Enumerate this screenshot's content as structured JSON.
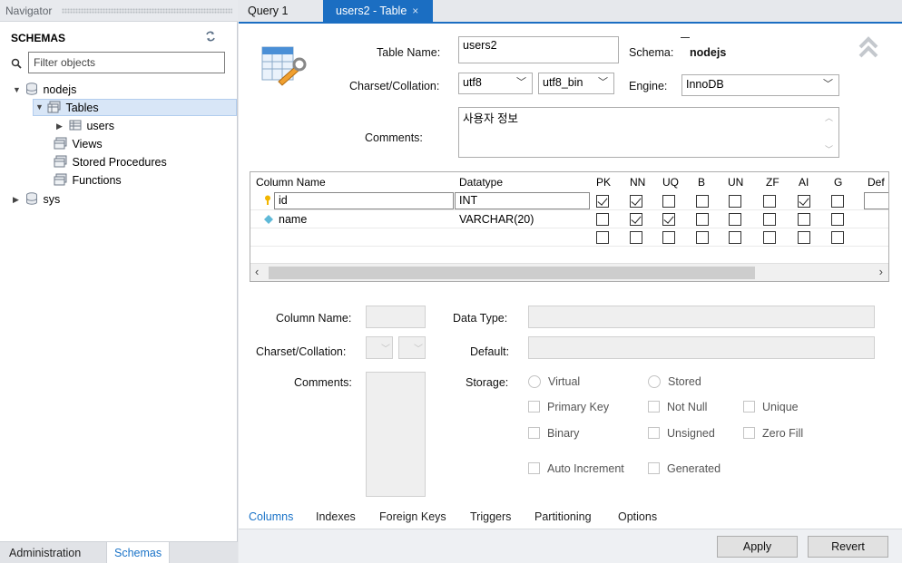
{
  "navigator": {
    "title": "Navigator",
    "schemas_title": "SCHEMAS",
    "filter_placeholder": "Filter objects",
    "tree": {
      "schema1": "nodejs",
      "tables": "Tables",
      "table_users": "users",
      "views": "Views",
      "stored_procedures": "Stored Procedures",
      "functions": "Functions",
      "schema2": "sys"
    },
    "tabs": {
      "administration": "Administration",
      "schemas": "Schemas"
    }
  },
  "editor_tabs": {
    "query": "Query 1",
    "users_table": "users2 - Table",
    "close": "×"
  },
  "table_editor": {
    "table_name_label": "Table Name:",
    "table_name_value": "users2",
    "schema_label": "Schema:",
    "schema_value": "nodejs",
    "charset_label": "Charset/Collation:",
    "charset_value": "utf8",
    "collation_value": "utf8_bin",
    "engine_label": "Engine:",
    "engine_value": "InnoDB",
    "comments_label": "Comments:",
    "comments_value": "사용자 정보"
  },
  "grid": {
    "headers": [
      "Column Name",
      "Datatype",
      "PK",
      "NN",
      "UQ",
      "B",
      "UN",
      "ZF",
      "AI",
      "G",
      "Def"
    ],
    "rows": [
      {
        "name": "id",
        "datatype": "INT",
        "flags": [
          true,
          true,
          false,
          false,
          false,
          false,
          true,
          false
        ]
      },
      {
        "name": "name",
        "datatype": "VARCHAR(20)",
        "flags": [
          false,
          true,
          true,
          false,
          false,
          false,
          false,
          false
        ]
      },
      {
        "name": "",
        "datatype": "",
        "flags": [
          false,
          false,
          false,
          false,
          false,
          false,
          false,
          false
        ]
      }
    ]
  },
  "details": {
    "column_name_label": "Column Name:",
    "data_type_label": "Data Type:",
    "charset_label": "Charset/Collation:",
    "default_label": "Default:",
    "comments_label": "Comments:",
    "storage_label": "Storage:",
    "virtual": "Virtual",
    "stored": "Stored",
    "primary_key": "Primary Key",
    "not_null": "Not Null",
    "unique": "Unique",
    "binary": "Binary",
    "unsigned": "Unsigned",
    "zero_fill": "Zero Fill",
    "auto_increment": "Auto Increment",
    "generated": "Generated"
  },
  "bottom_tabs": [
    "Columns",
    "Indexes",
    "Foreign Keys",
    "Triggers",
    "Partitioning",
    "Options"
  ],
  "buttons": {
    "apply": "Apply",
    "revert": "Revert"
  },
  "colors": {
    "accent": "#1b6ec2",
    "active_tab_text": "#1a73c8"
  }
}
